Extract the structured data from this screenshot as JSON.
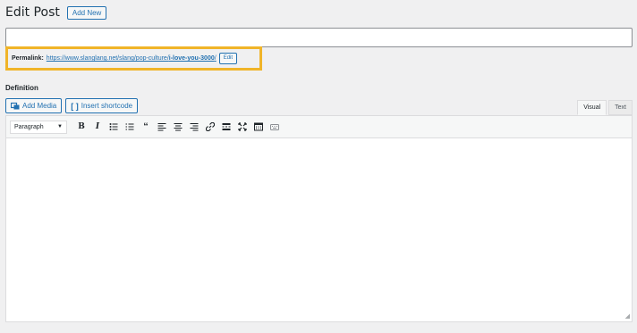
{
  "header": {
    "title": "Edit Post",
    "add_new_label": "Add New"
  },
  "title_field": {
    "value": ""
  },
  "permalink": {
    "label": "Permalink:",
    "url_base": "https://www.slanglang.net/slang/pop-culture/",
    "url_slug": "i-love-you-3000",
    "url_end": "/",
    "edit_label": "Edit"
  },
  "section": {
    "label": "Definition"
  },
  "media_buttons": {
    "add_media_label": "Add Media",
    "insert_shortcode_label": "Insert shortcode"
  },
  "editor_tabs": {
    "visual_label": "Visual",
    "text_label": "Text",
    "active": "visual"
  },
  "toolbar": {
    "format_value": "Paragraph",
    "buttons": [
      "bold-icon",
      "italic-icon",
      "bulleted-list-icon",
      "numbered-list-icon",
      "blockquote-icon",
      "align-left-icon",
      "align-center-icon",
      "align-right-icon",
      "link-icon",
      "read-more-icon",
      "fullscreen-icon",
      "toolbar-toggle-icon",
      "keyboard-icon"
    ]
  },
  "colors": {
    "accent": "#2271b1",
    "highlight": "#f0b429",
    "background": "#f0f0f1"
  }
}
